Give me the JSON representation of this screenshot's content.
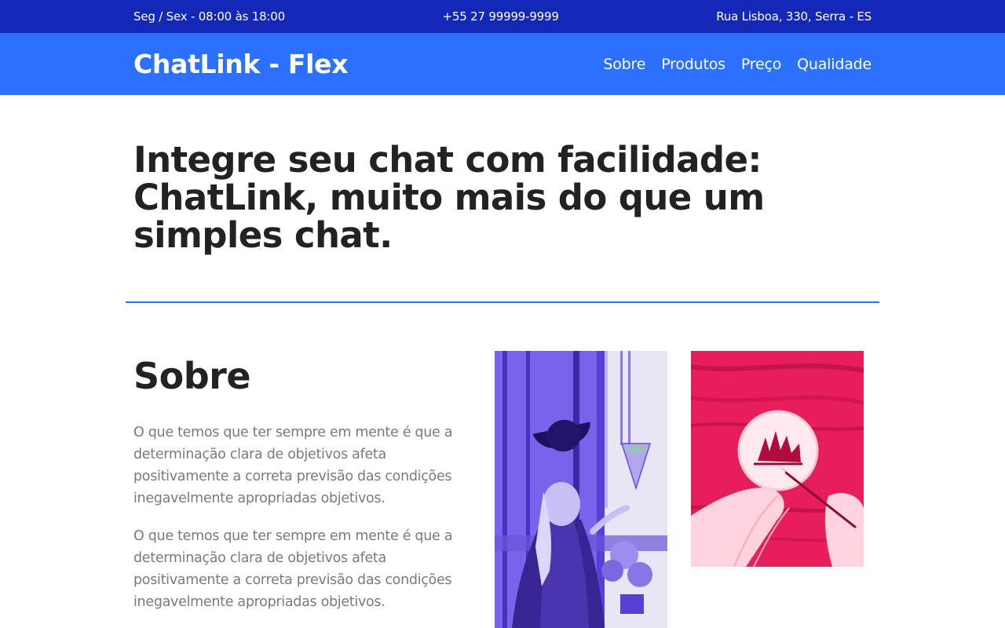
{
  "topbar": {
    "hours": "Seg / Sex - 08:00 às 18:00",
    "phone": "+55 27 99999-9999",
    "address": "Rua Lisboa, 330, Serra - ES"
  },
  "header": {
    "logo": "ChatLink - Flex",
    "nav": [
      {
        "label": "Sobre"
      },
      {
        "label": "Produtos"
      },
      {
        "label": "Preço"
      },
      {
        "label": "Qualidade"
      }
    ]
  },
  "hero": {
    "title": "Integre seu chat com facilidade: ChatLink, muito mais do que um simples chat."
  },
  "about": {
    "title": "Sobre",
    "paragraphs": [
      "O que temos que ter sempre em mente é que a determinação clara de objetivos afeta positivamente a correta previsão das condições inegavelmente apropriadas objetivos.",
      "O que temos que ter sempre em mente é que a determinação clara de objetivos afeta positivamente a correta previsão das condições inegavelmente apropriadas objetivos."
    ]
  },
  "colors": {
    "topbar": "#1428b8",
    "header": "#2b70ff",
    "accent": "#2b70ff",
    "image_purple_tint": "#6a4ce0",
    "image_red_tint": "#e81e5c"
  }
}
